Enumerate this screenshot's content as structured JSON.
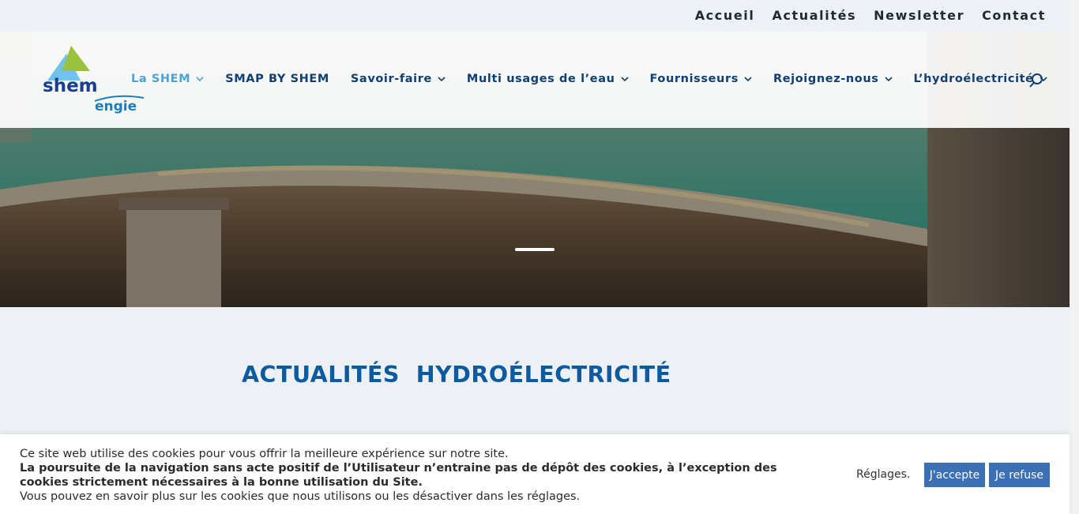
{
  "top_nav": {
    "items": [
      {
        "label": "Accueil"
      },
      {
        "label": "Actualités"
      },
      {
        "label": "Newsletter"
      },
      {
        "label": "Contact"
      }
    ]
  },
  "logo": {
    "brand": "shem",
    "partner": "engie"
  },
  "main_nav": {
    "items": [
      {
        "label": "La SHEM",
        "has_submenu": true,
        "active": true
      },
      {
        "label": "SMAP BY SHEM",
        "has_submenu": false,
        "active": false
      },
      {
        "label": "Savoir-faire",
        "has_submenu": true,
        "active": false
      },
      {
        "label": "Multi usages de l’eau",
        "has_submenu": true,
        "active": false
      },
      {
        "label": "Fournisseurs",
        "has_submenu": true,
        "active": false
      },
      {
        "label": "Rejoignez-nous",
        "has_submenu": true,
        "active": false
      },
      {
        "label": "L’hydroélectricité",
        "has_submenu": true,
        "active": false
      }
    ],
    "search_icon": "search-icon"
  },
  "hero": {
    "slider_active_index": 0
  },
  "page_title": "ACTUALITÉS  HYDROÉLECTRICITÉ",
  "cookie": {
    "line1": "Ce site web utilise des cookies pour vous offrir la meilleure expérience sur notre site.",
    "line2": "La poursuite de la navigation sans acte positif de l’Utilisateur n’entraine pas de dépôt des cookies, à l’exception des cookies strictement nécessaires à la bonne utilisation du Site.",
    "line3": "Vous pouvez en savoir plus sur les cookies que nous utilisons ou les désactiver dans les réglages.",
    "settings_label": "Réglages.",
    "accept_label": "J'accepte",
    "refuse_label": "Je refuse"
  },
  "colors": {
    "nav_text": "#0f3f73",
    "nav_active": "#4aa3da",
    "title": "#0c5aa0",
    "button": "#3d6fb5",
    "page_bg": "#edf1f5"
  }
}
